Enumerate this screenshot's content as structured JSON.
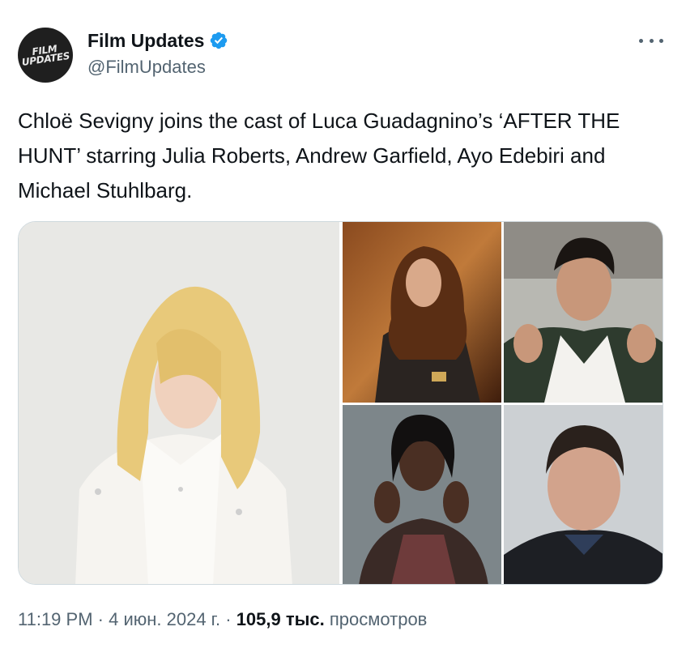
{
  "author": {
    "avatar_text": "FILM\nUPDATES",
    "display_name": "Film Updates",
    "handle": "@FilmUpdates",
    "verified_icon": "verified-badge-icon"
  },
  "tweet": {
    "text": "Chloë Sevigny joins the cast of Luca Guadagnino’s ‘AFTER THE HUNT’ starring Julia Roberts, Andrew Garfield, Ayo Edebiri and Michael Stuhlbarg."
  },
  "meta": {
    "time": "11:19 PM",
    "sep1": " · ",
    "date": "4 июн. 2024 г.",
    "sep2": " · ",
    "views_count": "105,9 тыс.",
    "views_label": " просмотров"
  },
  "colors": {
    "accent": "#1d9bf0",
    "text": "#0f1419",
    "secondary": "#536471"
  }
}
